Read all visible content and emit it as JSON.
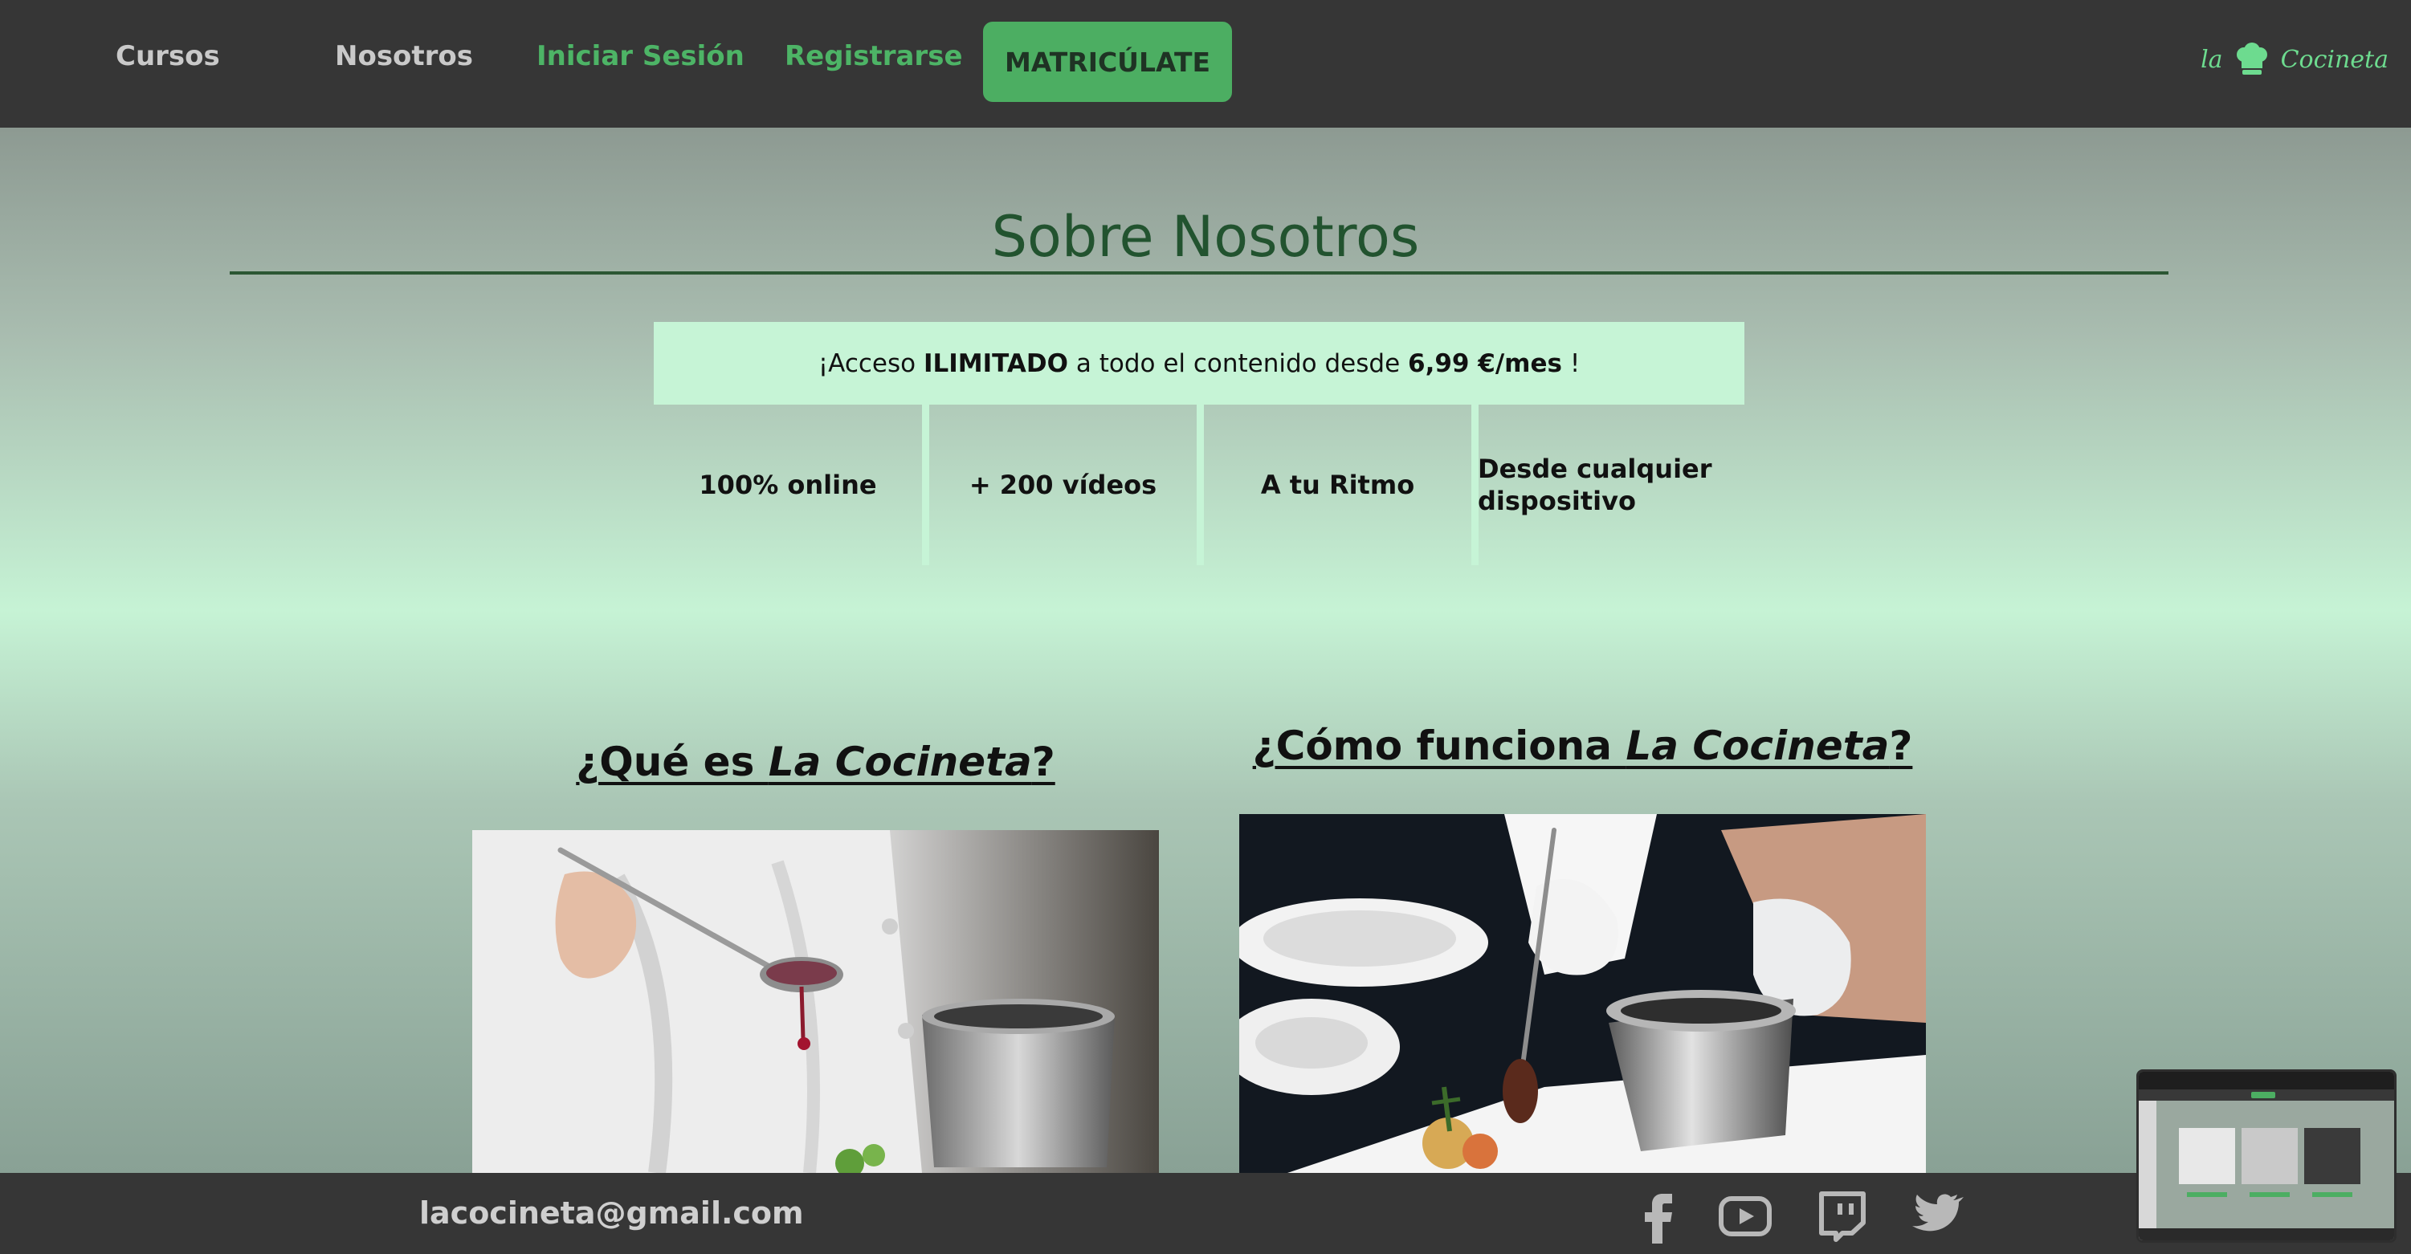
{
  "nav": {
    "items": [
      {
        "label": "Cursos"
      },
      {
        "label": "Nosotros"
      },
      {
        "label": "Iniciar Sesión"
      },
      {
        "label": "Registrarse"
      }
    ],
    "cta_label": "MATRICÚLATE",
    "logo": {
      "word1": "la",
      "word2": "Cocineta",
      "icon": "chef-hat-icon"
    }
  },
  "main": {
    "title": "Sobre Nosotros",
    "promo": {
      "prefix": "¡Acceso ",
      "highlight": "ILIMITADO",
      "middle": " a todo el contenido desde ",
      "price": "6,99 €/mes",
      "suffix": " !"
    },
    "features": [
      "100% online",
      "+ 200 vídeos",
      "A tu Ritmo",
      "Desde cualquier dispositivo"
    ],
    "columns": [
      {
        "heading_prefix": "¿Qué es ",
        "heading_brand": "La Cocineta",
        "heading_suffix": "?"
      },
      {
        "heading_prefix": "¿Cómo funciona ",
        "heading_brand": "La Cocineta",
        "heading_suffix": "?"
      }
    ]
  },
  "footer": {
    "email": "lacocineta@gmail.com",
    "social_icons": [
      "facebook-icon",
      "youtube-icon",
      "twitch-icon",
      "twitter-icon"
    ]
  },
  "colors": {
    "header_bg": "#363636",
    "accent_green": "#4cae62",
    "title_green": "#22532f",
    "promo_bg": "#c6f4d6"
  }
}
